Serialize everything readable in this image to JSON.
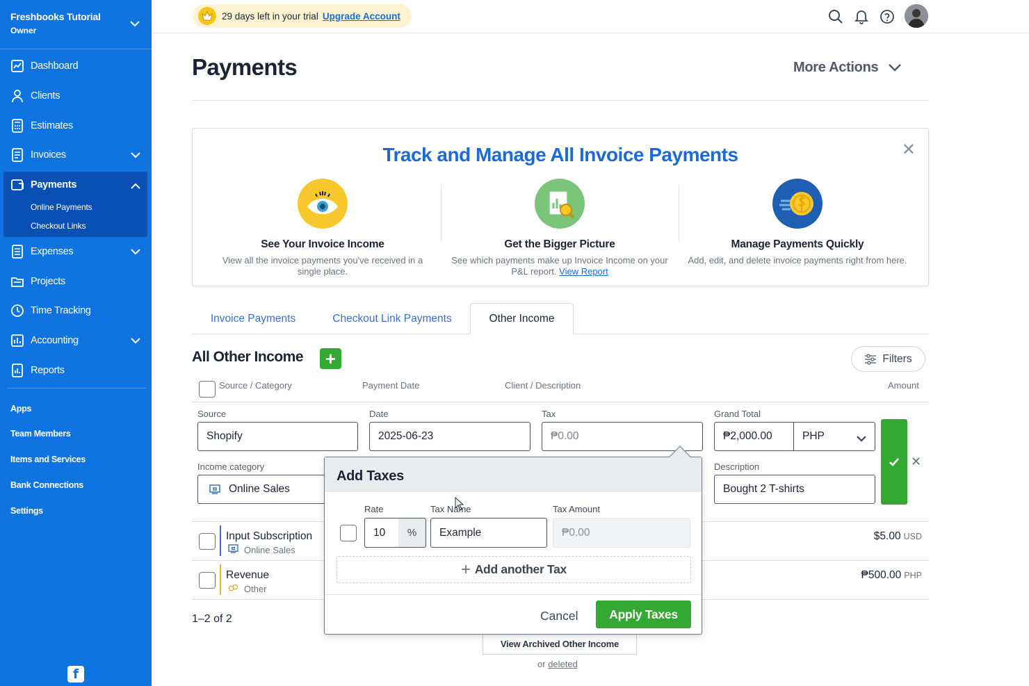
{
  "sidebar": {
    "company_name": "Freshbooks Tutorial",
    "company_role": "Owner",
    "nav": {
      "dashboard": "Dashboard",
      "clients": "Clients",
      "estimates": "Estimates",
      "invoices": "Invoices",
      "payments": "Payments",
      "online_payments": "Online Payments",
      "checkout_links": "Checkout Links",
      "expenses": "Expenses",
      "projects": "Projects",
      "time_tracking": "Time Tracking",
      "accounting": "Accounting",
      "reports": "Reports"
    },
    "links": {
      "apps": "Apps",
      "team_members": "Team Members",
      "items_services": "Items and Services",
      "bank_connections": "Bank Connections",
      "settings": "Settings"
    },
    "logo": "f",
    "accent_color": "#0f74e0"
  },
  "topbar": {
    "trial_text": "29 days left in your trial",
    "upgrade_link": "Upgrade Account"
  },
  "page": {
    "title": "Payments",
    "more_actions": "More Actions"
  },
  "promo": {
    "title": "Track and Manage All Invoice Payments",
    "col1_title": "See Your Invoice Income",
    "col1_text": "View all the invoice payments you've received in a single place.",
    "col2_title": "Get the Bigger Picture",
    "col2_text": "See which payments make up Invoice Income on your P&L report.",
    "col2_link": "View Report",
    "col3_title": "Manage Payments Quickly",
    "col3_text": "Add, edit, and delete invoice payments right from here."
  },
  "tabs": {
    "invoice_payments": "Invoice Payments",
    "checkout_link_payments": "Checkout Link Payments",
    "other_income": "Other Income"
  },
  "section": {
    "title": "All Other Income",
    "add_symbol": "+",
    "filters": "Filters"
  },
  "table": {
    "col_source": "Source / Category",
    "col_date": "Payment Date",
    "col_client": "Client / Description",
    "col_amount": "Amount"
  },
  "edit_row": {
    "source_label": "Source",
    "source_value": "Shopify",
    "date_label": "Date",
    "date_value": "2025-06-23",
    "tax_label": "Tax",
    "tax_value": "₱0.00",
    "grand_total_label": "Grand Total",
    "grand_total_value": "₱2,000.00",
    "currency": "PHP",
    "income_category_label": "Income category",
    "income_category_value": "Online Sales",
    "description_label": "Description",
    "description_value": "Bought 2 T-shirts"
  },
  "rows": [
    {
      "name": "Input Subscription",
      "category": "Online Sales",
      "amount": "$5.00",
      "currency": "USD"
    },
    {
      "name": "Revenue",
      "category": "Other",
      "amount": "₱500.00",
      "currency": "PHP"
    }
  ],
  "pagination": "1–2  of  2",
  "archived_button": "View Archived Other Income",
  "deleted_prefix": "or",
  "deleted_link": "deleted",
  "popover": {
    "title": "Add Taxes",
    "rate_label": "Rate",
    "tax_name_label": "Tax Name",
    "tax_amount_label": "Tax Amount",
    "rate_value": "10",
    "percent": "%",
    "tax_name_value": "Example",
    "tax_amount_value": "₱0.00",
    "add_another": "Add another Tax",
    "cancel": "Cancel",
    "apply": "Apply Taxes"
  }
}
